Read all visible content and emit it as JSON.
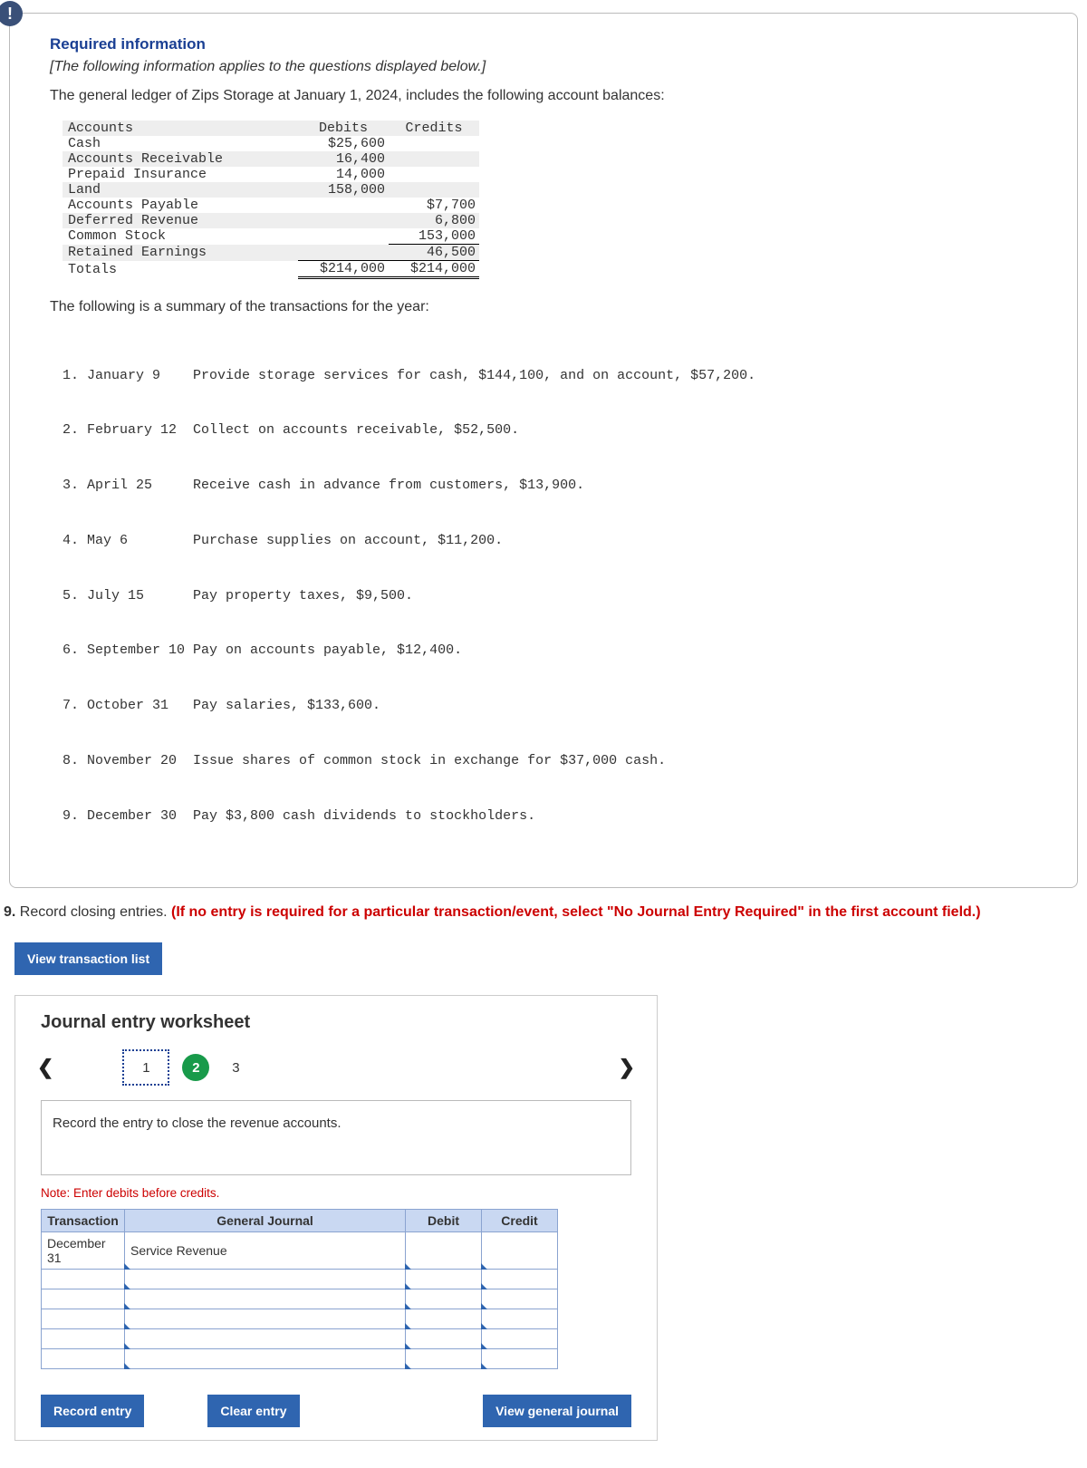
{
  "alert_glyph": "!",
  "required_title": "Required information",
  "italic_note": "[The following information applies to the questions displayed below.]",
  "lead_sentence": "The general ledger of Zips Storage at January 1, 2024, includes the following account balances:",
  "ledger": {
    "head_accounts": "Accounts",
    "head_debits": "Debits",
    "head_credits": "Credits",
    "rows": [
      {
        "name": "Cash",
        "debit": "$25,600",
        "credit": ""
      },
      {
        "name": "Accounts Receivable",
        "debit": "16,400",
        "credit": ""
      },
      {
        "name": "Prepaid Insurance",
        "debit": "14,000",
        "credit": ""
      },
      {
        "name": "Land",
        "debit": "158,000",
        "credit": ""
      },
      {
        "name": "Accounts Payable",
        "debit": "",
        "credit": "$7,700"
      },
      {
        "name": "Deferred Revenue",
        "debit": "",
        "credit": "6,800"
      },
      {
        "name": "Common Stock",
        "debit": "",
        "credit": "153,000"
      },
      {
        "name": "Retained Earnings",
        "debit": "",
        "credit": "46,500"
      }
    ],
    "totals_label": "   Totals",
    "totals_debit": "$214,000",
    "totals_credit": "$214,000"
  },
  "between_sentence": "The following is a summary of the transactions for the year:",
  "transactions": [
    "1. January 9    Provide storage services for cash, $144,100, and on account, $57,200.",
    "2. February 12  Collect on accounts receivable, $52,500.",
    "3. April 25     Receive cash in advance from customers, $13,900.",
    "4. May 6        Purchase supplies on account, $11,200.",
    "5. July 15      Pay property taxes, $9,500.",
    "6. September 10 Pay on accounts payable, $12,400.",
    "7. October 31   Pay salaries, $133,600.",
    "8. November 20  Issue shares of common stock in exchange for $37,000 cash.",
    "9. December 30  Pay $3,800 cash dividends to stockholders."
  ],
  "question": {
    "number": "9.",
    "black": " Record closing entries. ",
    "red": "(If no entry is required for a particular transaction/event, select \"No Journal Entry Required\" in the first account field.)"
  },
  "view_txn_list_label": "View transaction list",
  "worksheet_title": "Journal entry worksheet",
  "pager": {
    "p1": "1",
    "p2": "2",
    "p3": "3"
  },
  "instruction_text": "Record the entry to close the revenue accounts.",
  "red_note": "Note: Enter debits before credits.",
  "je_headers": {
    "transaction": "Transaction",
    "general_journal": "General Journal",
    "debit": "Debit",
    "credit": "Credit"
  },
  "je_rows": [
    {
      "txn": "December 31",
      "gj": "Service Revenue",
      "debit": "",
      "credit": ""
    },
    {
      "txn": "",
      "gj": "",
      "debit": "",
      "credit": ""
    },
    {
      "txn": "",
      "gj": "",
      "debit": "",
      "credit": ""
    },
    {
      "txn": "",
      "gj": "",
      "debit": "",
      "credit": ""
    },
    {
      "txn": "",
      "gj": "",
      "debit": "",
      "credit": ""
    },
    {
      "txn": "",
      "gj": "",
      "debit": "",
      "credit": ""
    }
  ],
  "buttons": {
    "record": "Record entry",
    "clear": "Clear entry",
    "view_journal": "View general journal"
  }
}
